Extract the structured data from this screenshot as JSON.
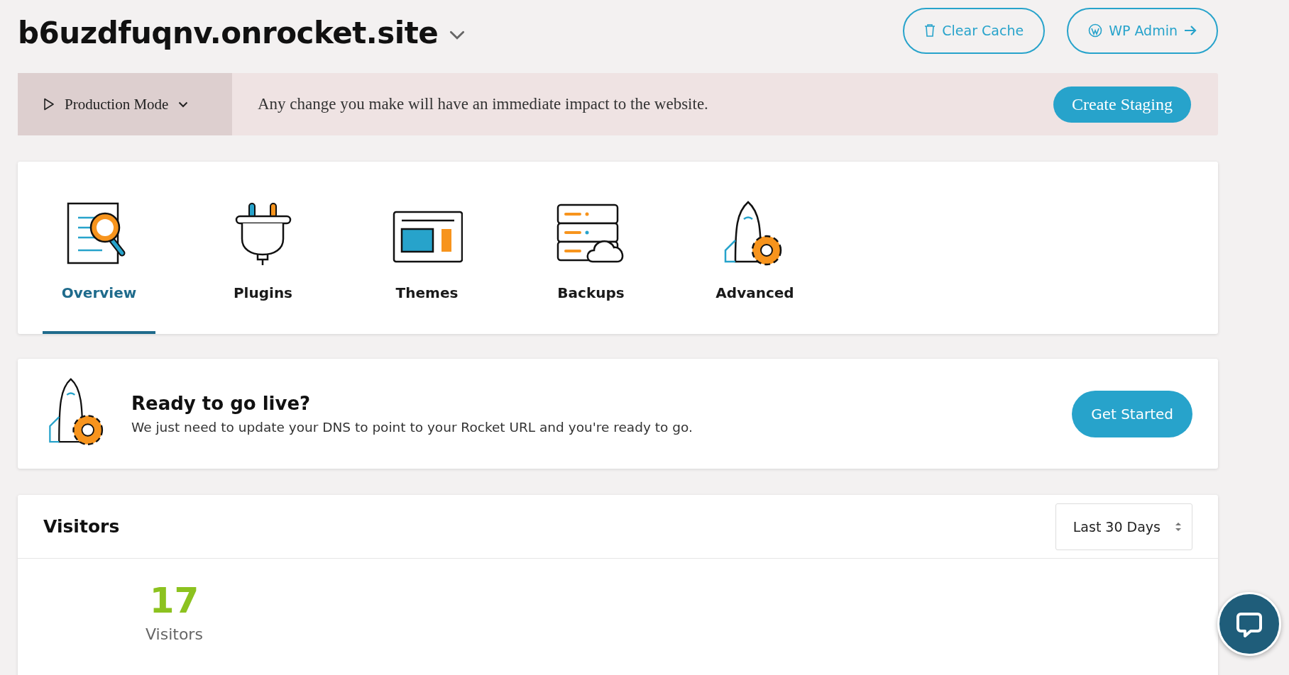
{
  "site": {
    "domain": "b6uzdfuqnv.onrocket.site"
  },
  "header_buttons": [
    {
      "kind": "cache",
      "label": "Clear Cache"
    },
    {
      "kind": "wp",
      "label": "WP Admin"
    }
  ],
  "mode_bar": {
    "mode": "Production Mode",
    "message": "Any change you make will have an immediate impact to the website.",
    "button": "Create Staging"
  },
  "tabs": [
    {
      "kind": "overview",
      "label": "Overview",
      "selected": true
    },
    {
      "kind": "plugins",
      "label": "Plugins",
      "selected": false
    },
    {
      "kind": "themes",
      "label": "Themes",
      "selected": false
    },
    {
      "kind": "backups",
      "label": "Backups",
      "selected": false
    },
    {
      "kind": "advanced",
      "label": "Advanced",
      "selected": false
    }
  ],
  "go_live": {
    "title": "Ready to go live?",
    "text": "We just need to update your DNS to point to your Rocket URL and you're ready to go.",
    "button": "Get Started"
  },
  "visitors": {
    "title": "Visitors",
    "range": "Last 30 Days",
    "count": "17",
    "label": "Visitors"
  }
}
